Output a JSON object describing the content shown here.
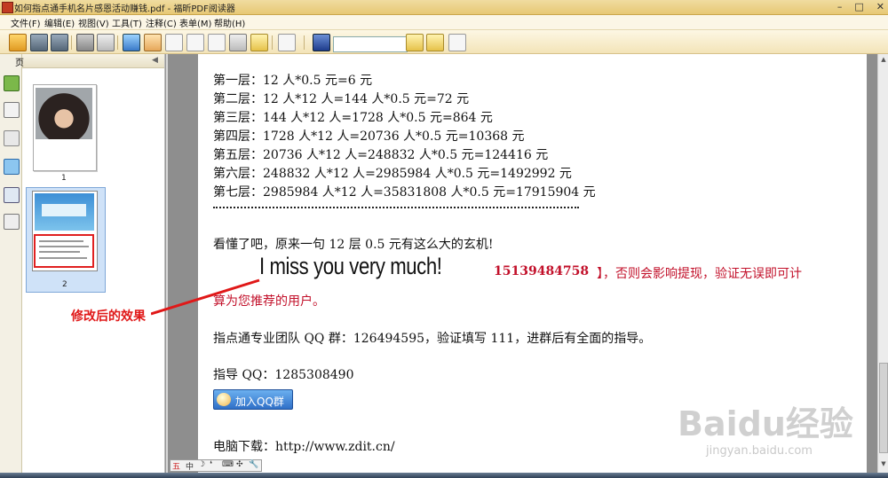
{
  "window": {
    "title": "如何指点通手机名片感恩活动赚钱.pdf - 福昕PDF阅读器"
  },
  "menu": [
    "文件(F)",
    "编辑(E)",
    "视图(V)",
    "工具(T)",
    "注释(C)",
    "表单(M)",
    "帮助(H)"
  ],
  "sidebar": {
    "header": "页",
    "pages": [
      "1",
      "2"
    ],
    "selected_page": "2"
  },
  "document": {
    "layers": [
      "第一层：12 人*0.5 元=6 元",
      "第二层：12 人*12 人=144 人*0.5 元=72 元",
      "第三层：144 人*12 人=1728 人*0.5 元=864 元",
      "第四层：1728 人*12 人=20736 人*0.5 元=10368 元",
      "第五层：20736 人*12 人=248832 人*0.5 元=124416 元",
      "第六层：248832 人*12 人=2985984 人*0.5 元=1492992 元",
      "第七层：2985984 人*12 人=35831808 人*0.5 元=17915904 元"
    ],
    "summary": "看懂了吧，原来一句 12 层 0.5 元有这么大的玄机!",
    "handwritten": "I miss you very much!",
    "phone": "15139484758",
    "phone_tail": "】，否则会影响提现，验证无误即可计",
    "phone_line2": "算为您推荐的用户。",
    "qq_group_line": "指点通专业团队 QQ 群：126494595，验证填写 111，进群后有全面的指导。",
    "qq_guide": "指导 QQ：1285308490",
    "qq_button": "加入QQ群",
    "download": "电脑下载：http://www.zdit.cn/"
  },
  "annotation": {
    "label": "修改后的效果",
    "color": "#e01818"
  },
  "ime": {
    "items": [
      "五",
      "中",
      "☽",
      "❛",
      "⌨",
      "✣",
      "🔧"
    ]
  },
  "watermark": {
    "brand": "Baidu经验",
    "url": "jingyan.baidu.com"
  },
  "colors": {
    "accent_red": "#d01414",
    "toolbar_bg": "#f3e4b8"
  }
}
